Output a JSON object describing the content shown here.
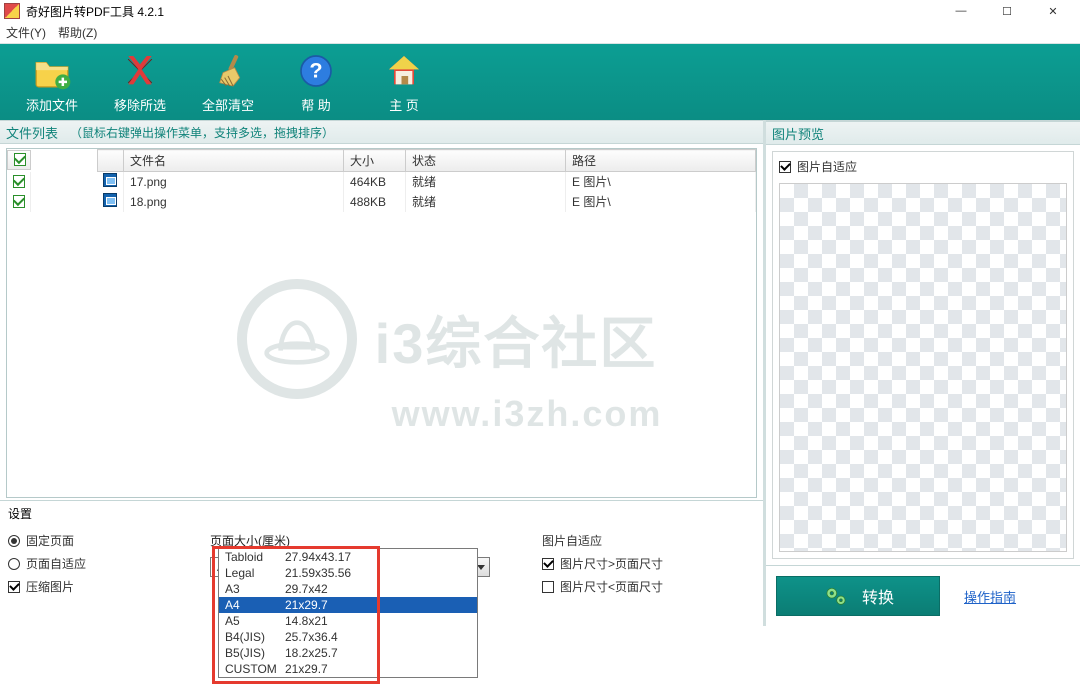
{
  "titlebar": {
    "title": "奇好图片转PDF工具 4.2.1"
  },
  "menubar": {
    "file": "文件(Y)",
    "help": "帮助(Z)"
  },
  "toolbar": {
    "add": "添加文件",
    "remove": "移除所选",
    "clear": "全部清空",
    "help": "帮 助",
    "home": "主 页"
  },
  "filelist": {
    "section": "文件列表",
    "hint": "（鼠标右键弹出操作菜单，支持多选，拖拽排序）",
    "cols": {
      "name": "文件名",
      "size": "大小",
      "status": "状态",
      "path": "路径"
    },
    "rows": [
      {
        "name": "17.png",
        "size": "464KB",
        "status": "就绪",
        "path": "E                    图片\\"
      },
      {
        "name": "18.png",
        "size": "488KB",
        "status": "就绪",
        "path": "E                    图片\\"
      }
    ]
  },
  "watermark": {
    "line1": "i3综合社区",
    "url": "www.i3zh.com"
  },
  "settings": {
    "label": "设置",
    "fixed": "固定页面",
    "auto": "页面自适应",
    "compress": "压缩图片",
    "pagesize_label": "页面大小(厘米)",
    "sel_name": "A4",
    "sel_dim": "21x29.7",
    "options": [
      {
        "name": "Tabloid",
        "dim": "27.94x43.17"
      },
      {
        "name": "Legal",
        "dim": "21.59x35.56"
      },
      {
        "name": "A3",
        "dim": "29.7x42"
      },
      {
        "name": "A4",
        "dim": "21x29.7"
      },
      {
        "name": "A5",
        "dim": "14.8x21"
      },
      {
        "name": "B4(JIS)",
        "dim": "25.7x36.4"
      },
      {
        "name": "B5(JIS)",
        "dim": "18.2x25.7"
      },
      {
        "name": "CUSTOM",
        "dim": "21x29.7"
      }
    ],
    "auto_section": "图片自适应",
    "gt": "图片尺寸>页面尺寸",
    "lt": "图片尺寸<页面尺寸"
  },
  "preview": {
    "section": "图片预览",
    "fit": "图片自适应"
  },
  "convert": {
    "btn": "转换",
    "guide": "操作指南"
  }
}
